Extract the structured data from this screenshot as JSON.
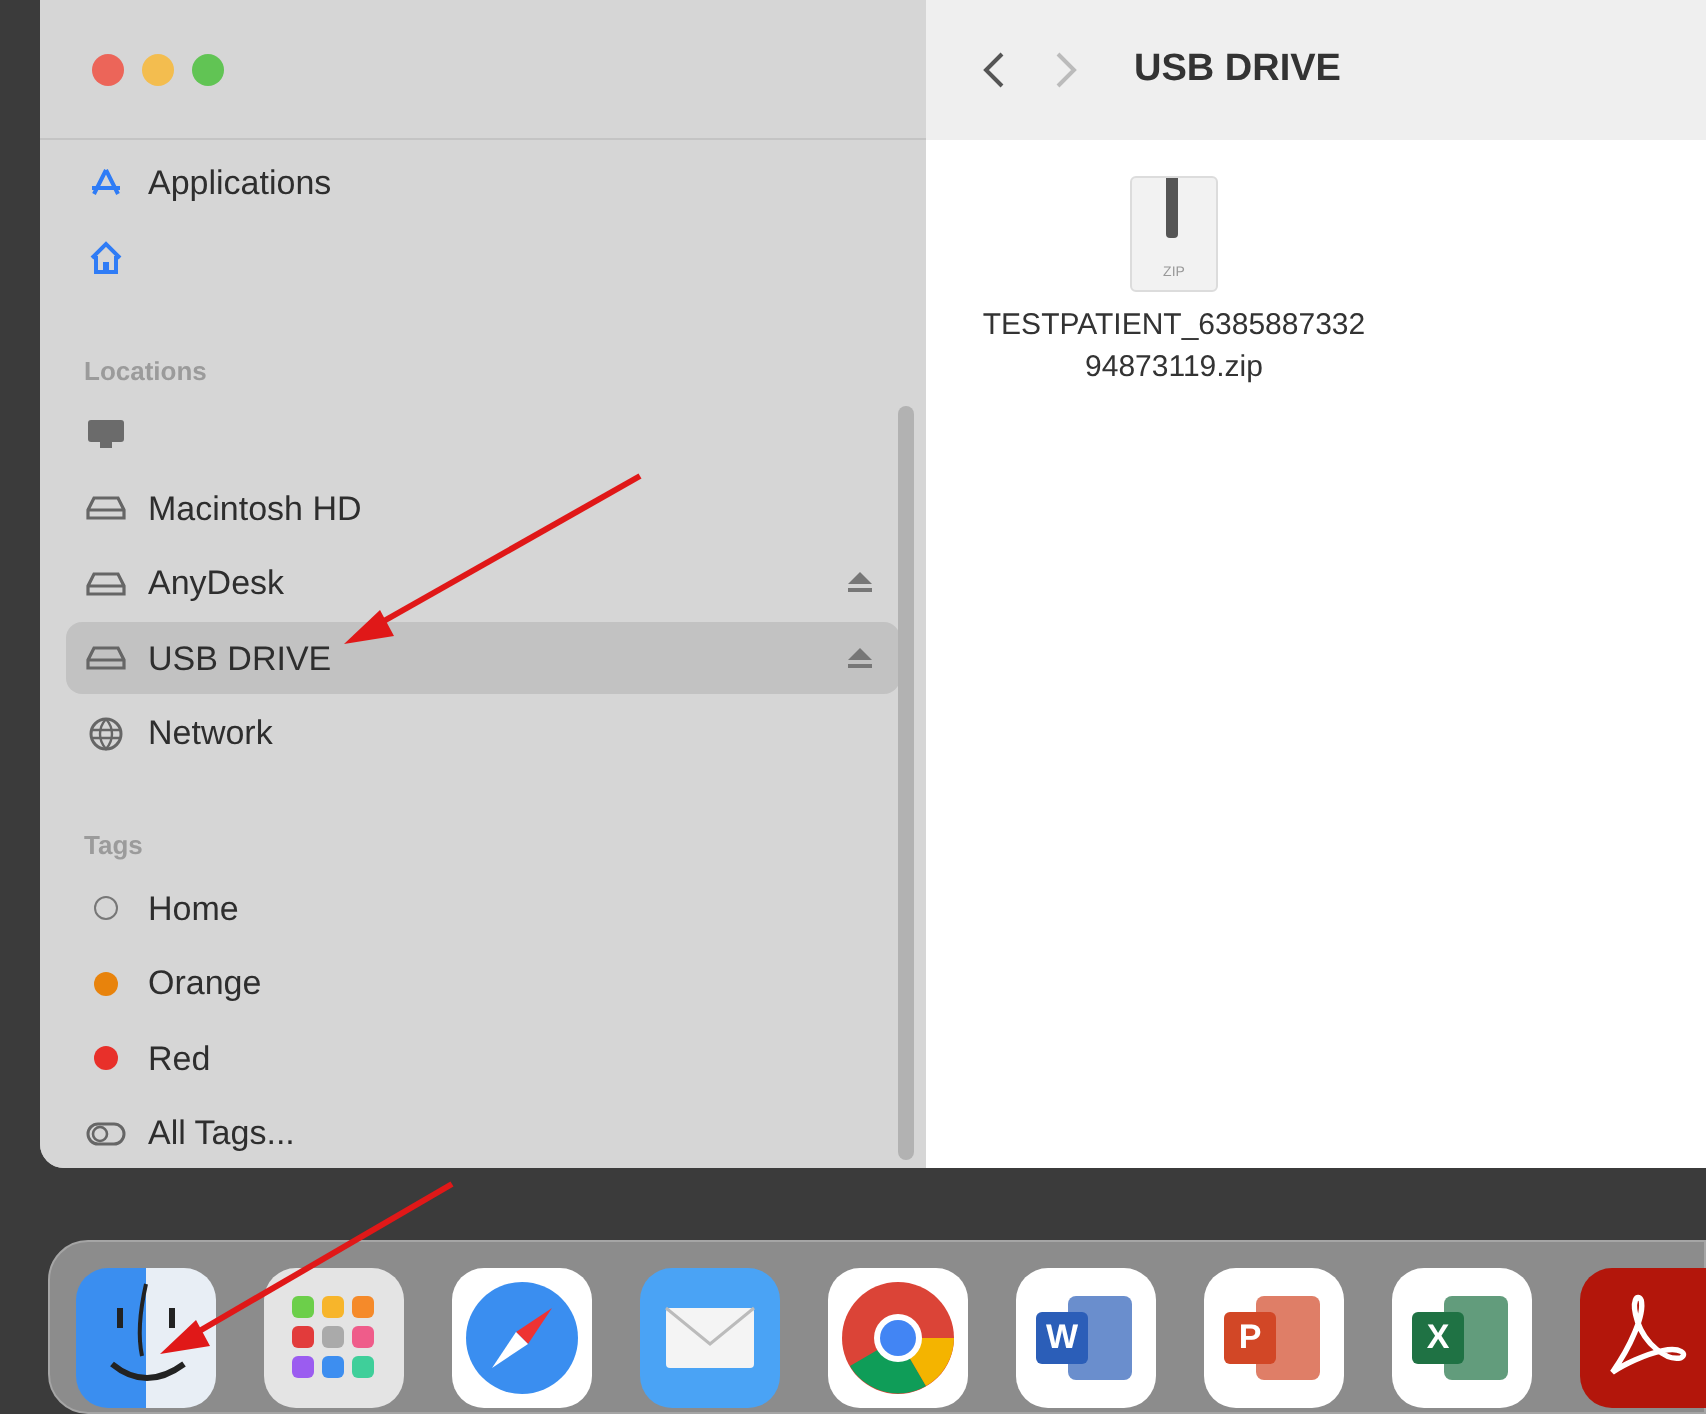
{
  "window": {
    "title": "USB DRIVE"
  },
  "sidebar": {
    "items": [
      {
        "kind": "apps",
        "label": "Applications",
        "selected": false
      },
      {
        "kind": "home",
        "selected": false
      },
      {
        "kind": "section",
        "label": "Locations"
      },
      {
        "kind": "computer",
        "selected": false
      },
      {
        "kind": "disk",
        "label": "Macintosh HD",
        "eject": false,
        "selected": false
      },
      {
        "kind": "disk",
        "label": "AnyDesk",
        "eject": true,
        "selected": false
      },
      {
        "kind": "disk",
        "label": "USB DRIVE",
        "eject": true,
        "selected": true
      },
      {
        "kind": "network",
        "label": "Network",
        "selected": false
      },
      {
        "kind": "section",
        "label": "Tags"
      },
      {
        "kind": "tag",
        "label": "Home",
        "selected": false
      },
      {
        "kind": "tag",
        "label": "Orange",
        "color": "#e8830c",
        "selected": false
      },
      {
        "kind": "tag",
        "label": "Red",
        "color": "#e8302a",
        "selected": false
      },
      {
        "kind": "alltags",
        "label": "All Tags...",
        "selected": false
      }
    ]
  },
  "files": [
    {
      "type_label": "ZIP",
      "name_lines": [
        "TESTPATIENT_6385887332",
        "94873119.zip"
      ]
    }
  ],
  "dock": [
    {
      "kind": "finder"
    },
    {
      "kind": "launchpad"
    },
    {
      "kind": "safari"
    },
    {
      "kind": "mail"
    },
    {
      "kind": "chrome"
    },
    {
      "kind": "word",
      "glyph": "W"
    },
    {
      "kind": "powerpoint",
      "glyph": "P"
    },
    {
      "kind": "excel",
      "glyph": "X"
    },
    {
      "kind": "acrobat"
    }
  ]
}
